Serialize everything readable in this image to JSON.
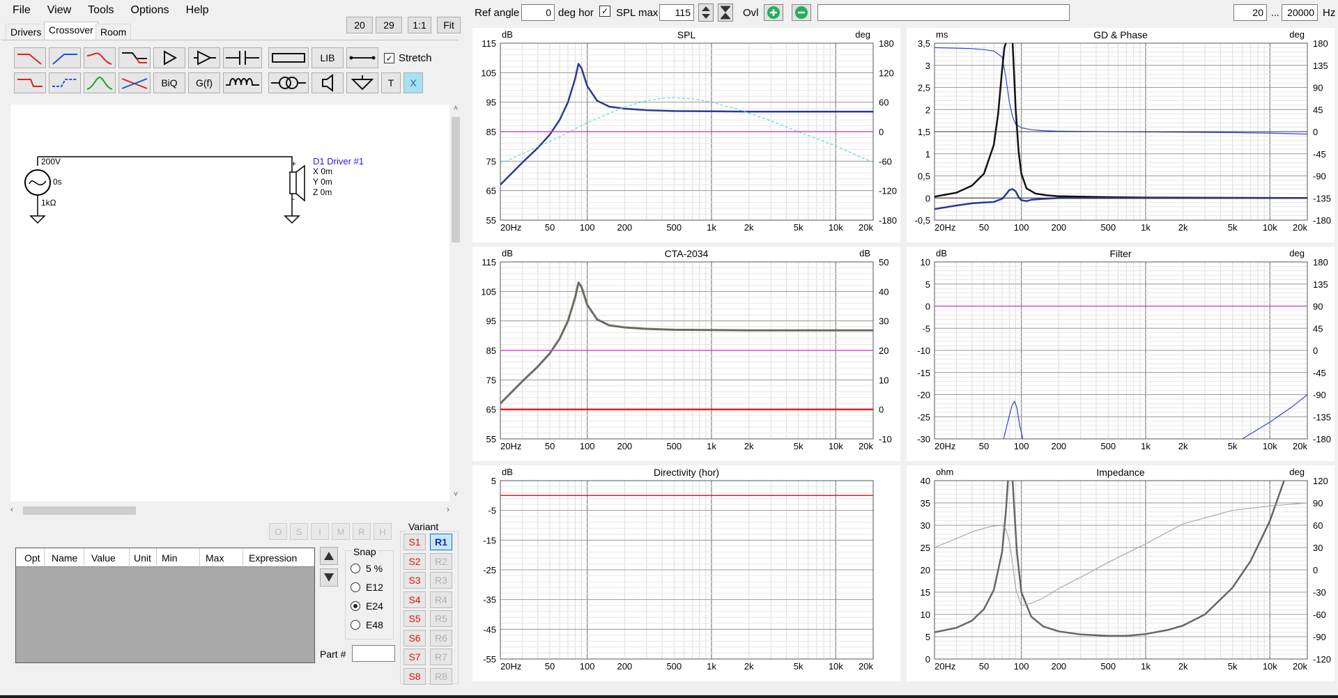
{
  "menu": [
    "File",
    "View",
    "Tools",
    "Options",
    "Help"
  ],
  "topButtons": [
    "20",
    "29",
    "1:1",
    "Fit"
  ],
  "tabs": [
    "Drivers",
    "Crossover",
    "Room"
  ],
  "tools": {
    "lib": "LIB",
    "biq": "BiQ",
    "gf": "G(f)",
    "t": "T",
    "x": "X",
    "stretch": "Stretch"
  },
  "schematic": {
    "source_voltage": "200V",
    "source_delay": "0s",
    "source_impedance": "1kΩ",
    "driver_name": "D1 Driver #1",
    "driver_x": "X 0m",
    "driver_y": "Y 0m",
    "driver_z": "Z 0m",
    "plus": "+",
    "minus": "-"
  },
  "disabledButtons": [
    "O",
    "S",
    "I",
    "M",
    "R",
    "H"
  ],
  "table": {
    "columns": [
      "Opt",
      "Name",
      "Value",
      "Unit",
      "Min",
      "Max",
      "Expression"
    ]
  },
  "snap": {
    "label": "Snap",
    "options": [
      "5 %",
      "E12",
      "E24",
      "E48"
    ],
    "selected": "E24"
  },
  "partLabel": "Part #",
  "variant": {
    "label": "Variant",
    "s": [
      "S1",
      "S2",
      "S3",
      "S4",
      "S5",
      "S6",
      "S7",
      "S8"
    ],
    "r": [
      "R1",
      "R2",
      "R3",
      "R4",
      "R5",
      "R6",
      "R7",
      "R8"
    ],
    "active": "R1"
  },
  "toolbar": {
    "ref_angle_label": "Ref angle",
    "ref_angle_value": "0",
    "deg_hor": "deg hor",
    "spl_max_label": "SPL max",
    "spl_max_value": "115",
    "ovl_label": "Ovl",
    "freq_min": "20",
    "freq_sep": "...",
    "freq_max": "20000",
    "hz": "Hz"
  },
  "colors": {
    "spl": "#2b3990",
    "dir": "#5fd4d4",
    "ref": "#d44ad4",
    "red": "#e02020",
    "grey": "#666666",
    "lightgrey": "#a8a8a8",
    "cta": "#6b6b5e",
    "phaseblue": "#3040e0"
  },
  "freqTicks": [
    "20Hz",
    "50",
    "100",
    "200",
    "500",
    "1k",
    "2k",
    "5k",
    "10k",
    "20k"
  ],
  "chart_data": [
    {
      "type": "line",
      "title": "SPL",
      "y_unit": "dB",
      "y2_unit": "deg",
      "yTicks": [
        "115",
        "105",
        "95",
        "85",
        "75",
        "65",
        "55"
      ],
      "y2Ticks": [
        "180",
        "120",
        "60",
        "0",
        "-60",
        "-120",
        "-180"
      ],
      "ylim": [
        55,
        115
      ],
      "y2lim": [
        -180,
        180
      ],
      "series": [
        {
          "axis": "y",
          "color": "#2b3990",
          "width": 2.5,
          "x": [
            20,
            30,
            40,
            50,
            60,
            70,
            80,
            85,
            90,
            100,
            120,
            150,
            200,
            300,
            500,
            1000,
            2000,
            5000,
            10000,
            20000
          ],
          "y": [
            67,
            74.5,
            79.5,
            84,
            89,
            95,
            103,
            108,
            106.5,
            100.5,
            95.5,
            93.5,
            92.8,
            92.3,
            92,
            91.9,
            91.8,
            91.8,
            91.8,
            91.8
          ]
        },
        {
          "axis": "y2",
          "color": "#5fd4d4",
          "width": 1.2,
          "dash": "4,3",
          "x": [
            20,
            30,
            50,
            70,
            100,
            150,
            200,
            300,
            400,
            500,
            700,
            1000,
            1500,
            2000,
            3000,
            5000,
            7000,
            10000,
            15000,
            20000
          ],
          "y": [
            -65,
            -45,
            -20,
            -2,
            18,
            37,
            50,
            63,
            68,
            69,
            67,
            60,
            48,
            38,
            22,
            0,
            -14,
            -29,
            -49,
            -62
          ]
        },
        {
          "axis": "y",
          "color": "#d44ad4",
          "width": 1.5,
          "x": [
            20,
            20000
          ],
          "y": [
            85,
            85
          ]
        }
      ]
    },
    {
      "type": "line",
      "title": "GD & Phase",
      "y_unit": "ms",
      "y2_unit": "deg",
      "yTicks": [
        "3,5",
        "3",
        "2,5",
        "2",
        "1,5",
        "1",
        "0,5",
        "0",
        "-0,5"
      ],
      "y2Ticks": [
        "180",
        "135",
        "90",
        "45",
        "0",
        "-45",
        "-90",
        "-135",
        "-180"
      ],
      "ylim": [
        -0.5,
        3.5
      ],
      "y2lim": [
        -180,
        180
      ],
      "series": [
        {
          "axis": "y2",
          "color": "#3040e0",
          "width": 1.2,
          "x": [
            20,
            30,
            40,
            50,
            60,
            70,
            75,
            80,
            85,
            90,
            100,
            120,
            150,
            200,
            500,
            1000,
            5000,
            10000,
            20000
          ],
          "y": [
            171,
            170,
            169,
            167,
            164,
            152,
            110,
            60,
            30,
            15,
            8,
            4,
            2,
            1,
            0,
            -0.5,
            -2,
            -3,
            -5
          ]
        },
        {
          "axis": "y",
          "color": "#111111",
          "width": 2.5,
          "x": [
            20,
            30,
            40,
            50,
            60,
            65,
            70,
            73,
            75
          ],
          "y": [
            0.03,
            0.12,
            0.28,
            0.55,
            1.2,
            1.9,
            2.9,
            3.4,
            3.5
          ]
        },
        {
          "axis": "y",
          "color": "#111111",
          "width": 2.5,
          "x": [
            85,
            87,
            90,
            95,
            100,
            110,
            130,
            160,
            200,
            500,
            1000,
            20000
          ],
          "y": [
            3.5,
            2.9,
            2.0,
            1.05,
            0.55,
            0.22,
            0.1,
            0.06,
            0.04,
            0.02,
            0.01,
            0
          ]
        },
        {
          "axis": "y",
          "color": "#2b3990",
          "width": 2.5,
          "x": [
            20,
            30,
            40,
            50,
            60,
            65,
            70,
            75,
            80,
            85,
            90,
            95,
            100,
            110,
            120,
            150,
            200,
            500,
            20000
          ],
          "y": [
            -0.25,
            -0.17,
            -0.12,
            -0.1,
            -0.09,
            -0.05,
            -0.02,
            0.08,
            0.18,
            0.2,
            0.15,
            0.02,
            -0.05,
            -0.07,
            -0.04,
            -0.02,
            0,
            0,
            0
          ]
        },
        {
          "axis": "y",
          "color": "#333333",
          "width": 1,
          "x": [
            20,
            20000
          ],
          "y": [
            1.5,
            1.5
          ]
        },
        {
          "axis": "y",
          "color": "#333333",
          "width": 1,
          "x": [
            20,
            20000
          ],
          "y": [
            0,
            0
          ]
        }
      ]
    },
    {
      "type": "line",
      "title": "CTA-2034",
      "y_unit": "dB",
      "y2_unit": "dB",
      "yTicks": [
        "115",
        "105",
        "95",
        "85",
        "75",
        "65",
        "55"
      ],
      "y2Ticks": [
        "50",
        "40",
        "30",
        "20",
        "10",
        "0",
        "-10"
      ],
      "ylim": [
        55,
        115
      ],
      "y2lim": [
        -10,
        50
      ],
      "series": [
        {
          "axis": "y",
          "color": "#6b6b5e",
          "width": 3,
          "x": [
            20,
            30,
            40,
            50,
            60,
            70,
            80,
            85,
            90,
            100,
            120,
            150,
            200,
            300,
            500,
            1000,
            2000,
            5000,
            10000,
            20000
          ],
          "y": [
            67,
            74.5,
            79.5,
            84,
            89,
            95,
            103,
            108,
            106.5,
            100.5,
            95.5,
            93.5,
            92.8,
            92.3,
            92,
            91.9,
            91.8,
            91.8,
            91.8,
            91.8
          ]
        },
        {
          "axis": "y",
          "color": "#d44ad4",
          "width": 1.5,
          "x": [
            20,
            20000
          ],
          "y": [
            85,
            85
          ]
        },
        {
          "axis": "y",
          "color": "#e02020",
          "width": 2.5,
          "x": [
            20,
            20000
          ],
          "y": [
            65,
            65
          ]
        }
      ]
    },
    {
      "type": "line",
      "title": "Filter",
      "y_unit": "dB",
      "y2_unit": "deg",
      "yTicks": [
        "10",
        "5",
        "0",
        "-5",
        "-10",
        "-15",
        "-20",
        "-25",
        "-30"
      ],
      "y2Ticks": [
        "180",
        "135",
        "90",
        "45",
        "0",
        "-45",
        "-90",
        "-135",
        "-180"
      ],
      "ylim": [
        -30,
        10
      ],
      "y2lim": [
        -180,
        180
      ],
      "series": [
        {
          "axis": "y",
          "color": "#d44ad4",
          "width": 1.5,
          "x": [
            20,
            20000
          ],
          "y": [
            0,
            0
          ]
        },
        {
          "axis": "y",
          "color": "#3040e0",
          "width": 1.2,
          "x": [
            72,
            78,
            84,
            88,
            92,
            97,
            103
          ],
          "y": [
            -30,
            -26,
            -22.5,
            -21.5,
            -23,
            -27,
            -30
          ]
        },
        {
          "axis": "y",
          "color": "#3040e0",
          "width": 1.2,
          "x": [
            6000,
            10000,
            15000,
            20000
          ],
          "y": [
            -30,
            -26.2,
            -22.8,
            -20
          ]
        }
      ]
    },
    {
      "type": "line",
      "title": "Directivity (hor)",
      "y_unit": "dB",
      "y2_unit": "",
      "yTicks": [
        "5",
        "-5",
        "-15",
        "-25",
        "-35",
        "-45",
        "-55"
      ],
      "y2Ticks": [],
      "ylim": [
        -55,
        5
      ],
      "y2lim": [
        -55,
        5
      ],
      "series": [
        {
          "axis": "y",
          "color": "#e02020",
          "width": 1.5,
          "x": [
            20,
            20000
          ],
          "y": [
            0,
            0
          ]
        }
      ]
    },
    {
      "type": "line",
      "title": "Impedance",
      "y_unit": "ohm",
      "y2_unit": "deg",
      "yTicks": [
        "40",
        "35",
        "30",
        "25",
        "20",
        "15",
        "10",
        "5",
        "0"
      ],
      "y2Ticks": [
        "120",
        "90",
        "60",
        "30",
        "0",
        "-30",
        "-60",
        "-90",
        "-120"
      ],
      "ylim": [
        0,
        40
      ],
      "y2lim": [
        -120,
        120
      ],
      "series": [
        {
          "axis": "y",
          "color": "#666666",
          "width": 2.5,
          "x": [
            20,
            30,
            40,
            50,
            60,
            70,
            75,
            78
          ],
          "y": [
            6,
            7,
            8.6,
            11.2,
            15.5,
            24,
            33,
            40
          ]
        },
        {
          "axis": "y",
          "color": "#666666",
          "width": 2.5,
          "x": [
            85,
            88,
            92,
            100,
            120,
            150,
            200,
            300,
            500,
            700,
            1000,
            1500,
            2000,
            3000,
            5000,
            7000,
            10000,
            13000
          ],
          "y": [
            40,
            33,
            24,
            15,
            9.5,
            7.3,
            6.2,
            5.5,
            5.2,
            5.2,
            5.6,
            6.5,
            7.5,
            10,
            16,
            22,
            31,
            40
          ]
        },
        {
          "axis": "y2",
          "color": "#a8a8a8",
          "width": 1.2,
          "x": [
            20,
            30,
            40,
            50,
            60,
            70,
            75,
            80,
            85,
            90,
            100,
            120,
            150,
            200,
            300,
            500,
            1000,
            2000,
            5000,
            10000,
            20000
          ],
          "y": [
            30,
            42,
            51,
            56,
            59,
            60,
            55,
            38,
            8,
            -25,
            -48,
            -45,
            -38,
            -25,
            -10,
            10,
            35,
            62,
            80,
            86,
            90
          ]
        }
      ]
    }
  ]
}
